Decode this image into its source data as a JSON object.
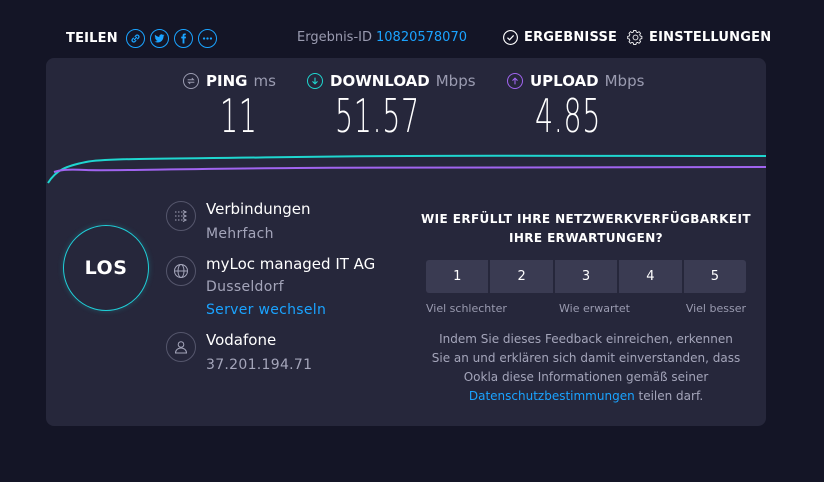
{
  "header": {
    "share_label": "TEILEN",
    "share_icons": [
      "link-icon",
      "twitter-icon",
      "facebook-icon",
      "more-icon"
    ],
    "result_label": "Ergebnis-ID",
    "result_id": "10820578070",
    "results_label": "ERGEBNISSE",
    "settings_label": "EINSTELLUNGEN"
  },
  "metrics": {
    "ping": {
      "label": "PING",
      "unit": "ms",
      "value": "11",
      "icon": "ping-icon"
    },
    "download": {
      "label": "DOWNLOAD",
      "unit": "Mbps",
      "value": "51.57",
      "icon": "download-arrow-icon"
    },
    "upload": {
      "label": "UPLOAD",
      "unit": "Mbps",
      "value": "4.85",
      "icon": "upload-arrow-icon"
    }
  },
  "colors": {
    "download": "#1fd6cf",
    "upload": "#a064f0",
    "accent": "#1aa3ff",
    "card": "#26273b"
  },
  "go_label": "LOS",
  "connections": {
    "title": "Verbindungen",
    "value": "Mehrfach"
  },
  "server": {
    "name": "myLoc managed IT AG",
    "location": "Dusseldorf",
    "change_label": "Server wechseln"
  },
  "provider": {
    "name": "Vodafone",
    "ip": "37.201.194.71"
  },
  "feedback": {
    "question_line1": "WIE ERFÜLLT IHRE NETZWERKVERFÜGBARKEIT",
    "question_line2": "IHRE ERWARTUNGEN?",
    "ratings": [
      "1",
      "2",
      "3",
      "4",
      "5"
    ],
    "scale_low": "Viel schlechter",
    "scale_mid": "Wie erwartet",
    "scale_high": "Viel besser",
    "text_line1": "Indem Sie dieses Feedback einreichen, erkennen",
    "text_line2": "Sie an und erklären sich damit einverstanden, dass",
    "text_line3": "Ookla diese Informationen gemäß seiner",
    "privacy_link": "Datenschutzbestimmungen",
    "text_end": " teilen darf."
  }
}
